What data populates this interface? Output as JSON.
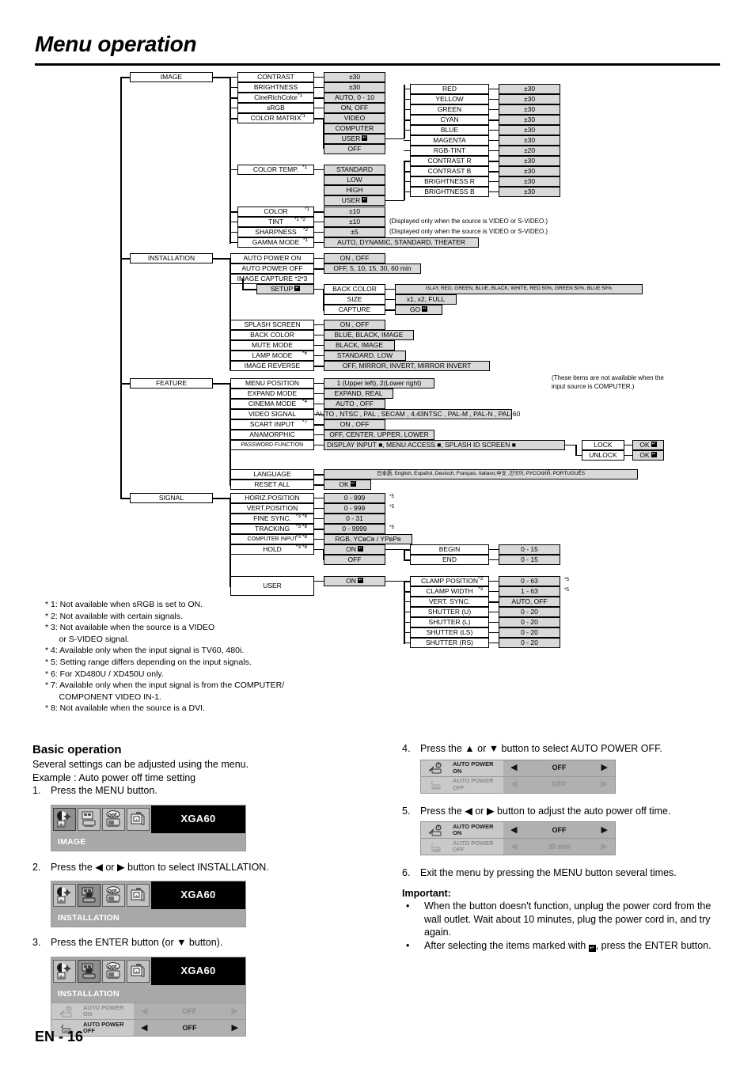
{
  "page": {
    "title": "Menu operation",
    "number": "EN - 16"
  },
  "tree": {
    "menus": [
      {
        "label": "IMAGE"
      },
      {
        "label": "INSTALLATION"
      },
      {
        "label": "FEATURE"
      },
      {
        "label": "SIGNAL"
      }
    ],
    "image_items": [
      {
        "label": "CONTRAST",
        "note": "",
        "value": "±30"
      },
      {
        "label": "BRIGHTNESS",
        "note": "",
        "value": "±30"
      },
      {
        "label": "CineRichColor",
        "note": "*1",
        "value": "AUTO, 0 - 10"
      },
      {
        "label": "sRGB",
        "note": "",
        "value": "ON, OFF"
      },
      {
        "label": "COLOR MATRIX",
        "note": "*1",
        "value": "VIDEO"
      }
    ],
    "color_matrix_values": [
      "VIDEO",
      "COMPUTER",
      "USER",
      "OFF"
    ],
    "color_temp_label": "COLOR TEMP.",
    "color_temp_note": "*1",
    "color_temp_values": [
      "STANDARD",
      "LOW",
      "HIGH",
      "USER"
    ],
    "user_matrix_items": [
      {
        "label": "RED",
        "value": "±30"
      },
      {
        "label": "YELLOW",
        "value": "±30"
      },
      {
        "label": "GREEN",
        "value": "±30"
      },
      {
        "label": "CYAN",
        "value": "±30"
      },
      {
        "label": "BLUE",
        "value": "±30"
      },
      {
        "label": "MAGENTA",
        "value": "±30"
      },
      {
        "label": "RGB-TINT",
        "value": "±20"
      }
    ],
    "user_temp_items": [
      {
        "label": "CONTRAST R",
        "value": "±30"
      },
      {
        "label": "CONTRAST B",
        "value": "±30"
      },
      {
        "label": "BRIGHTNESS R",
        "value": "±30"
      },
      {
        "label": "BRIGHTNESS B",
        "value": "±30"
      }
    ],
    "image_items2": [
      {
        "label": "COLOR",
        "note": "*1",
        "value": "±10",
        "side": ""
      },
      {
        "label": "TINT",
        "note": "*1 *2",
        "value": "±10",
        "side": "(Displayed only when the source is VIDEO or S-VIDEO.)"
      },
      {
        "label": "SHARPNESS",
        "note": "*2",
        "value": "±5",
        "side": "(Displayed only when the source is VIDEO or S-VIDEO.)"
      },
      {
        "label": "GAMMA MODE",
        "note": "*1",
        "value": "AUTO, DYNAMIC, STANDARD, THEATER",
        "side": ""
      }
    ],
    "installation_items": [
      {
        "label": "AUTO POWER ON",
        "note": "",
        "value": "ON , OFF"
      },
      {
        "label": "AUTO POWER OFF",
        "note": "",
        "value": "OFF,  5,  10,  15,  30,  60 min"
      },
      {
        "label": "IMAGE CAPTURE *2*3",
        "note": "",
        "value": ""
      }
    ],
    "setup_label": "SETUP",
    "setup_items": [
      {
        "label": "BACK COLOR",
        "value": "GLAY, RED, GREEN, BLUE, BLACK, WHITE, RED 50%, GREEN 50%, BLUE 50%"
      },
      {
        "label": "SIZE",
        "value": "x1, x2, FULL"
      },
      {
        "label": "CAPTURE",
        "value": "GO"
      }
    ],
    "installation_items2": [
      {
        "label": "SPLASH SCREEN",
        "note": "",
        "value": "ON , OFF"
      },
      {
        "label": "BACK COLOR",
        "note": "",
        "value": "BLUE, BLACK, IMAGE"
      },
      {
        "label": "MUTE MODE",
        "note": "",
        "value": "BLACK, IMAGE"
      },
      {
        "label": "LAMP MODE",
        "note": "*6",
        "value": "STANDARD, LOW"
      },
      {
        "label": "IMAGE REVERSE",
        "note": "",
        "value": "OFF, MIRROR, INVERT, MIRROR INVERT"
      }
    ],
    "feature_items": [
      {
        "label": "MENU POSITION",
        "note": "",
        "value": "1 (Upper left), 2(Lower right)"
      },
      {
        "label": "EXPAND MODE",
        "note": "",
        "value": "EXPAND, REAL"
      },
      {
        "label": "CINEMA MODE",
        "note": "*4",
        "value": "AUTO , OFF"
      },
      {
        "label": "VIDEO SIGNAL",
        "note": "",
        "value": "AUTO , NTSC , PAL , SECAM , 4.43NTSC , PAL-M , PAL-N , PAL-60"
      },
      {
        "label": "SCART INPUT",
        "note": "*7",
        "value": "ON , OFF"
      },
      {
        "label": "ANAMORPHIC",
        "note": "",
        "value": "OFF, CENTER, UPPER, LOWER"
      },
      {
        "label": "PASSWORD FUNCTION",
        "note": "",
        "value": "DISPLAY INPUT ■, MENU ACCESS ■, SPLASH ID SCREEN ■"
      }
    ],
    "password_sub": [
      {
        "label": "LOCK",
        "value": "OK"
      },
      {
        "label": "UNLOCK",
        "value": "OK"
      }
    ],
    "feature_items2": [
      {
        "label": "LANGUAGE",
        "note": "",
        "value": "日本語, English, Español, Deutsch, Français, Italiano,中文 ,한국어, РУССКИЙ, PORTUGUÊS"
      },
      {
        "label": "RESET ALL",
        "note": "",
        "value": "OK"
      }
    ],
    "computer_note": "(These items are not available when the\ninput source is COMPUTER.)",
    "signal_items": [
      {
        "label": "HORIZ.POSITION",
        "note": "",
        "value": "0 - 999",
        "star": "*5"
      },
      {
        "label": "VERT.POSITION",
        "note": "",
        "value": "0 - 999",
        "star": "*5"
      },
      {
        "label": "FINE SYNC.",
        "note": "*3 *8",
        "value": "0 - 31",
        "star": ""
      },
      {
        "label": "TRACKING",
        "note": "*3 *8",
        "value": "0 - 9999",
        "star": "*5"
      },
      {
        "label": "COMPUTER INPUT",
        "note": "*3 *8",
        "value": "RGB, YCʙCʀ / YPʙPʀ",
        "star": ""
      },
      {
        "label": "HOLD",
        "note": "*3 *8",
        "value": "ON",
        "star": ""
      }
    ],
    "hold_off": "OFF",
    "hold_sub": [
      {
        "label": "BEGIN",
        "value": "0 - 15"
      },
      {
        "label": "END",
        "value": "0 - 15"
      }
    ],
    "user_label": "USER",
    "user_value": "ON",
    "user_sub": [
      {
        "label": "CLAMP POSITION",
        "note": "*3",
        "value": "0 - 63",
        "star": "*5"
      },
      {
        "label": "CLAMP WIDTH",
        "note": "*3",
        "value": "1 - 63",
        "star": "*5"
      },
      {
        "label": "VERT. SYNC.",
        "note": "",
        "value": "AUTO, OFF",
        "star": ""
      },
      {
        "label": "SHUTTER (U)",
        "note": "",
        "value": "0 - 20",
        "star": ""
      },
      {
        "label": "SHUTTER (L)",
        "note": "",
        "value": "0 - 20",
        "star": ""
      },
      {
        "label": "SHUTTER (LS)",
        "note": "",
        "value": "0 - 20",
        "star": ""
      },
      {
        "label": "SHUTTER (RS)",
        "note": "",
        "value": "0 - 20",
        "star": ""
      }
    ]
  },
  "footnotes": "* 1: Not available when sRGB is set to ON.\n* 2: Not available with certain signals.\n* 3: Not available when the source is a VIDEO\n      or S-VIDEO signal.\n* 4: Available only when the input signal is TV60, 480i.\n* 5: Setting range differs depending on the input signals.\n* 6: For XD480U / XD450U only.\n* 7: Available only when the input signal is from the COMPUTER/\n      COMPONENT VIDEO IN-1.\n* 8: Not available when the source is a DVI.",
  "basic": {
    "heading": "Basic operation",
    "line1": "Several settings can be adjusted using the menu.",
    "line2": "Example : Auto power off time setting",
    "step1_num": "1.",
    "step1": "Press the MENU button.",
    "step2_num": "2.",
    "step2": "Press the ◀ or ▶ button to select INSTALLATION.",
    "step3_num": "3.",
    "step3": "Press the ENTER button (or ▼ button).",
    "step4_num": "4.",
    "step4": "Press the ▲ or ▼ button to select AUTO POWER OFF.",
    "step5_num": "5.",
    "step5": "Press the ◀ or ▶ button to adjust the auto power off time.",
    "step6_num": "6.",
    "step6": "Exit the menu by pressing the MENU button several times.",
    "important_heading": "Important:",
    "bullet": "•",
    "important1": "When the button doesn't function,  unplug the power cord from the wall outlet. Wait about 10 minutes, plug the power cord in, and try again.",
    "important2a": "After selecting the items marked with",
    "important2b": ", press the ENTER button."
  },
  "osd": {
    "source": "XGA60",
    "menu_image": "IMAGE",
    "menu_installation": "INSTALLATION",
    "row_on_name1": "AUTO POWER",
    "row_on_name2": "ON",
    "row_off_name1": "AUTO POWER",
    "row_off_name2": "OFF",
    "value_off": "OFF",
    "value_30min": "30 min",
    "arrow_left": "◀",
    "arrow_right": "▶"
  }
}
